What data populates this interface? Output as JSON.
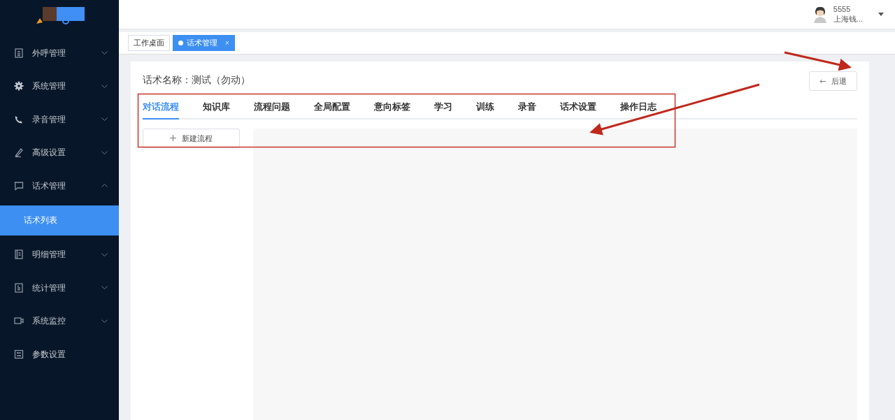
{
  "sidebar": {
    "items": [
      {
        "label": "外呼管理",
        "kind": "group",
        "expanded": false
      },
      {
        "label": "系统管理",
        "kind": "group",
        "expanded": false
      },
      {
        "label": "录音管理",
        "kind": "group",
        "expanded": false
      },
      {
        "label": "高级设置",
        "kind": "group",
        "expanded": false
      },
      {
        "label": "话术管理",
        "kind": "group",
        "expanded": true,
        "children": [
          {
            "label": "话术列表",
            "selected": true
          }
        ]
      },
      {
        "label": "明细管理",
        "kind": "group",
        "expanded": false
      },
      {
        "label": "统计管理",
        "kind": "group",
        "expanded": false
      },
      {
        "label": "系统监控",
        "kind": "group",
        "expanded": false
      },
      {
        "label": "参数设置",
        "kind": "link"
      }
    ]
  },
  "header": {
    "user": {
      "name": "5555",
      "org": "上海钱..."
    }
  },
  "tags": [
    {
      "label": "工作桌面",
      "selected": false
    },
    {
      "label": "话术管理",
      "selected": true,
      "close": "×"
    }
  ],
  "page": {
    "title": "话术名称：测试（勿动）",
    "back_button": "后退",
    "tabs": [
      {
        "label": "对话流程",
        "selected": true
      },
      {
        "label": "知识库",
        "selected": false
      },
      {
        "label": "流程问题",
        "selected": false
      },
      {
        "label": "全局配置",
        "selected": false
      },
      {
        "label": "意向标签",
        "selected": false
      },
      {
        "label": "学习",
        "selected": false
      },
      {
        "label": "训练",
        "selected": false
      },
      {
        "label": "录音",
        "selected": false
      },
      {
        "label": "话术设置",
        "selected": false
      },
      {
        "label": "操作日志",
        "selected": false
      }
    ],
    "new_flow_button": "新建流程"
  }
}
